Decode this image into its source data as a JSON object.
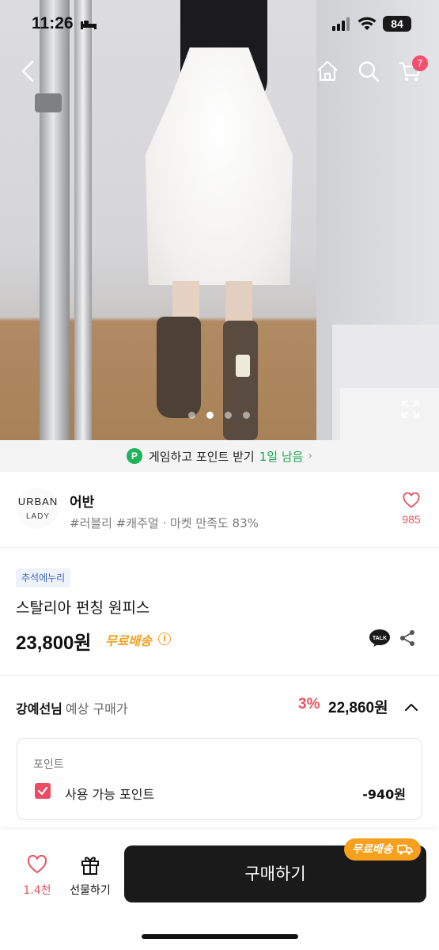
{
  "status": {
    "time": "11:26",
    "battery": "84"
  },
  "hero": {
    "current_slide": 2,
    "slides": 4
  },
  "cart": {
    "count": "7"
  },
  "game": {
    "text": "게임하고 포인트 받기",
    "days": "1일 남음",
    "icon": "P"
  },
  "shop": {
    "logo_line1": "URBAN",
    "logo_line2": "LADY",
    "name": "어반",
    "tags": "#러블리 #캐주얼 · 마켓 만족도 83%",
    "likes": "985"
  },
  "product": {
    "badge": "추석에누리",
    "title": "스탈리아 펀칭 원피스",
    "price": "23,800원",
    "shipping": "무료배송"
  },
  "member": {
    "name": "강예선님",
    "label": "예상 구매가",
    "discount": "3%",
    "price": "22,860원"
  },
  "points": {
    "header": "포인트",
    "label": "사용 가능 포인트",
    "value": "-940원",
    "checked": true
  },
  "bottom": {
    "likes": "1.4천",
    "gift": "선물하기",
    "buy": "구매하기",
    "ship_badge": "무료배송"
  },
  "colors": {
    "accent_red": "#e8535f",
    "ship_orange": "#f0a020",
    "green": "#1fb35a",
    "badge_blue": "#3b63b8"
  }
}
